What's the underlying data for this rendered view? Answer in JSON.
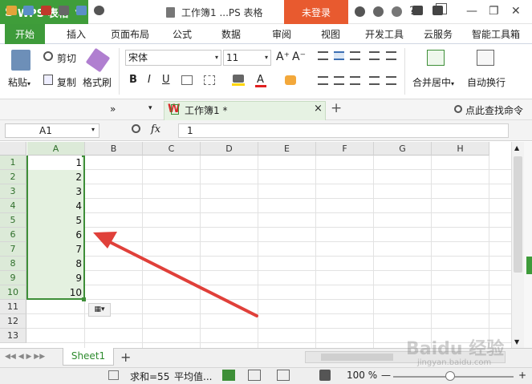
{
  "app": {
    "logo_letter": "S",
    "name": "WPS 表格",
    "dropdown": "▾"
  },
  "title": {
    "document": "工作簿1 ...PS 表格"
  },
  "login_label": "未登录",
  "window_buttons": {
    "minimize": "—",
    "restore": "❐",
    "close": "✕",
    "help": "?",
    "help_dd": "▾"
  },
  "menu_tabs": [
    "开始",
    "插入",
    "页面布局",
    "公式",
    "数据",
    "审阅",
    "视图",
    "开发工具",
    "云服务",
    "智能工具箱"
  ],
  "ribbon": {
    "paste": "粘贴",
    "paste_dd": "▾",
    "cut": "剪切",
    "copy": "复制",
    "format_painter": "格式刷",
    "font_name": "宋体",
    "font_size": "11",
    "grow_font": "A⁺",
    "shrink_font": "A⁻",
    "bold": "B",
    "italic": "I",
    "underline": "U",
    "font_color": "A",
    "merge_center": "合并居中",
    "wrap_text": "自动换行",
    "dd": "▾"
  },
  "qat": {
    "more": "»",
    "doc_tab": "工作簿1 *",
    "close": "×",
    "new_tab": "+",
    "search": "点此查找命令"
  },
  "formula_bar": {
    "name_box": "A1",
    "fx": "fx",
    "value": "1"
  },
  "grid": {
    "columns": [
      "A",
      "B",
      "C",
      "D",
      "E",
      "F",
      "G",
      "H"
    ],
    "rows": [
      "1",
      "2",
      "3",
      "4",
      "5",
      "6",
      "7",
      "8",
      "9",
      "10",
      "11",
      "12",
      "13"
    ],
    "column_a_values": [
      "1",
      "2",
      "3",
      "4",
      "5",
      "6",
      "7",
      "8",
      "9",
      "10"
    ]
  },
  "sheets": {
    "active": "Sheet1",
    "add": "+"
  },
  "status": {
    "sum": "求和=55",
    "avg": "平均值...",
    "zoom": "100 %",
    "minus": "—",
    "plus": "+"
  },
  "annotation_color": "#e0403a",
  "watermark": {
    "text": "Baidu 经验",
    "sub": "jingyan.baidu.com"
  }
}
